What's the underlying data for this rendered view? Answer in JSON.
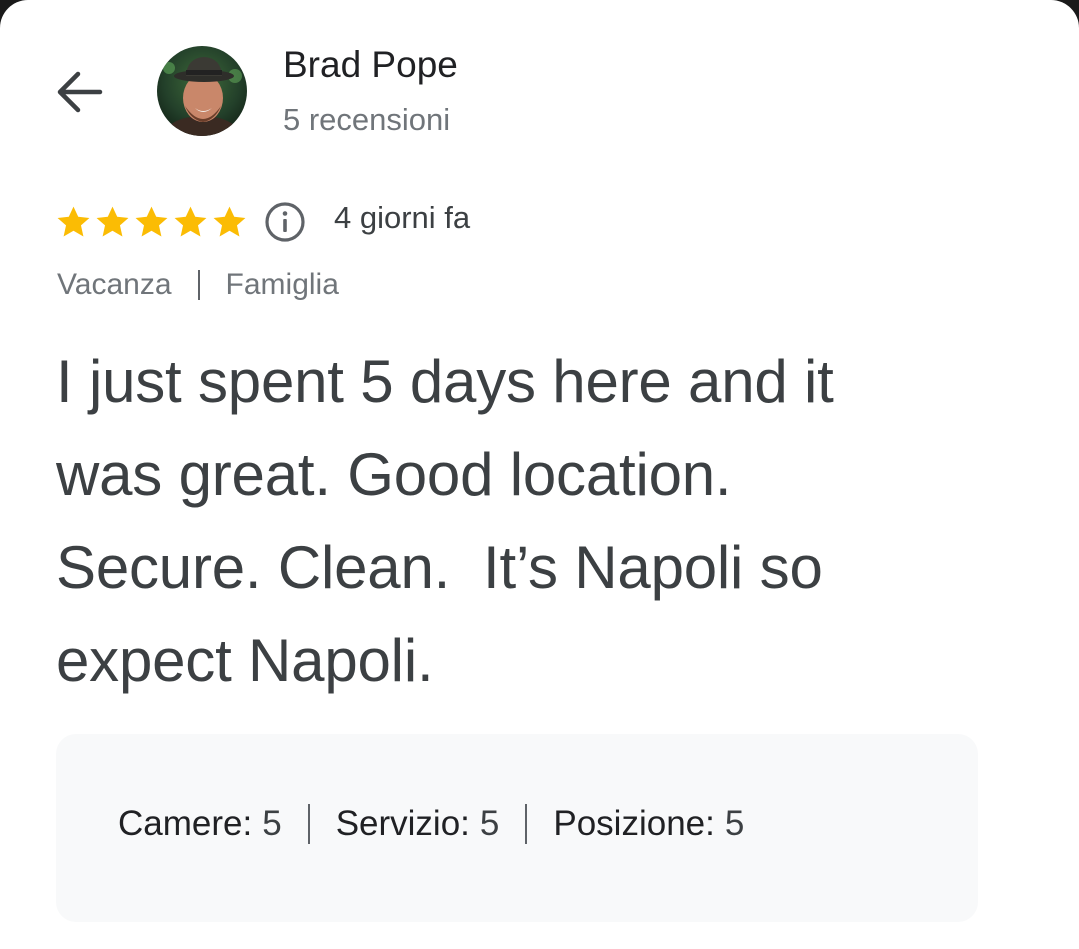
{
  "author": {
    "name": "Brad Pope",
    "reviews_count": "5 recensioni"
  },
  "review": {
    "rating": 5,
    "rating_max": 5,
    "star_color": "#fbbc04",
    "date": "4 giorni fa",
    "tags": [
      "Vacanza",
      "Famiglia"
    ],
    "text": "I just spent 5 days here and it\nwas great. Good location.\nSecure. Clean.  It’s Napoli so\nexpect Napoli."
  },
  "sub_ratings": [
    {
      "label": "Camere:",
      "value": "5"
    },
    {
      "label": "Servizio:",
      "value": "5"
    },
    {
      "label": "Posizione:",
      "value": "5"
    }
  ],
  "icons": {
    "back": "arrow-left-icon",
    "info": "info-icon",
    "star": "star-icon"
  }
}
